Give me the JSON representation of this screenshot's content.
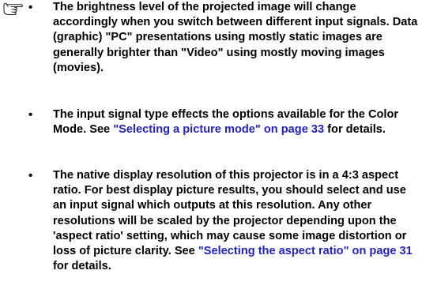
{
  "notes": [
    {
      "bullet": "•",
      "text": "The brightness level of the projected image will change accordingly when you switch between different input signals. Data (graphic) \"PC\" presentations using mostly static images are generally brighter than \"Video\" using mostly moving images (movies)."
    },
    {
      "bullet": "•",
      "text_before": "The input signal type effects the options available for the Color Mode. See ",
      "link": "\"Selecting a picture mode\" on page 33",
      "text_after": " for details."
    },
    {
      "bullet": "•",
      "text_before": "The native display resolution of this projector is in a 4:3 aspect ratio. For best display picture results, you should select and use an input signal which outputs at this resolution. Any other resolutions will be scaled by the projector depending upon the 'aspect ratio' setting, which may cause some image distortion or loss of picture clarity. See ",
      "link": "\"Selecting the aspect ratio\" on page 31",
      "text_after": " for details."
    }
  ],
  "colors": {
    "text": "#000000",
    "link": "#1f1fd6"
  },
  "icons": {
    "note": "pointing-hand-icon"
  }
}
